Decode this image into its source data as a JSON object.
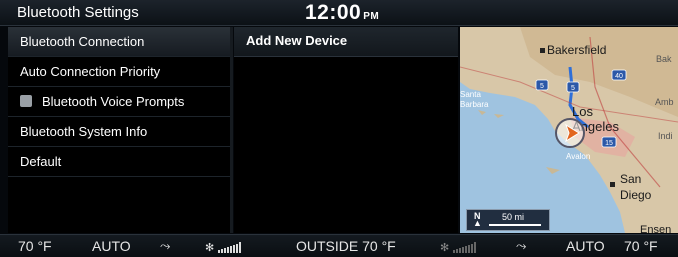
{
  "header": {
    "title": "Bluetooth Settings",
    "time": "12:00",
    "ampm": "PM"
  },
  "menu": {
    "items": [
      {
        "label": "Bluetooth Connection"
      },
      {
        "label": "Auto Connection Priority"
      },
      {
        "label": "Bluetooth Voice Prompts"
      },
      {
        "label": "Bluetooth System Info"
      },
      {
        "label": "Default"
      }
    ]
  },
  "devices": {
    "add_label": "Add New Device"
  },
  "map": {
    "cities": {
      "bakersfield": "Bakersfield",
      "bak": "Bak",
      "los": "Los",
      "angeles": "Angeles",
      "santa": "Santa",
      "barbara": "Barbara",
      "amb": "Amb",
      "indi": "Indi",
      "avalon": "Avalon",
      "san": "San",
      "diego": "Diego",
      "ensen": "Ensen"
    },
    "shields": [
      "5",
      "40",
      "5",
      "15"
    ],
    "compass": "N",
    "scale": "50 mi"
  },
  "climate": {
    "left_temp": "70 °F",
    "left_mode": "AUTO",
    "outside": "OUTSIDE  70 °F",
    "right_mode": "AUTO",
    "right_temp": "70 °F"
  }
}
